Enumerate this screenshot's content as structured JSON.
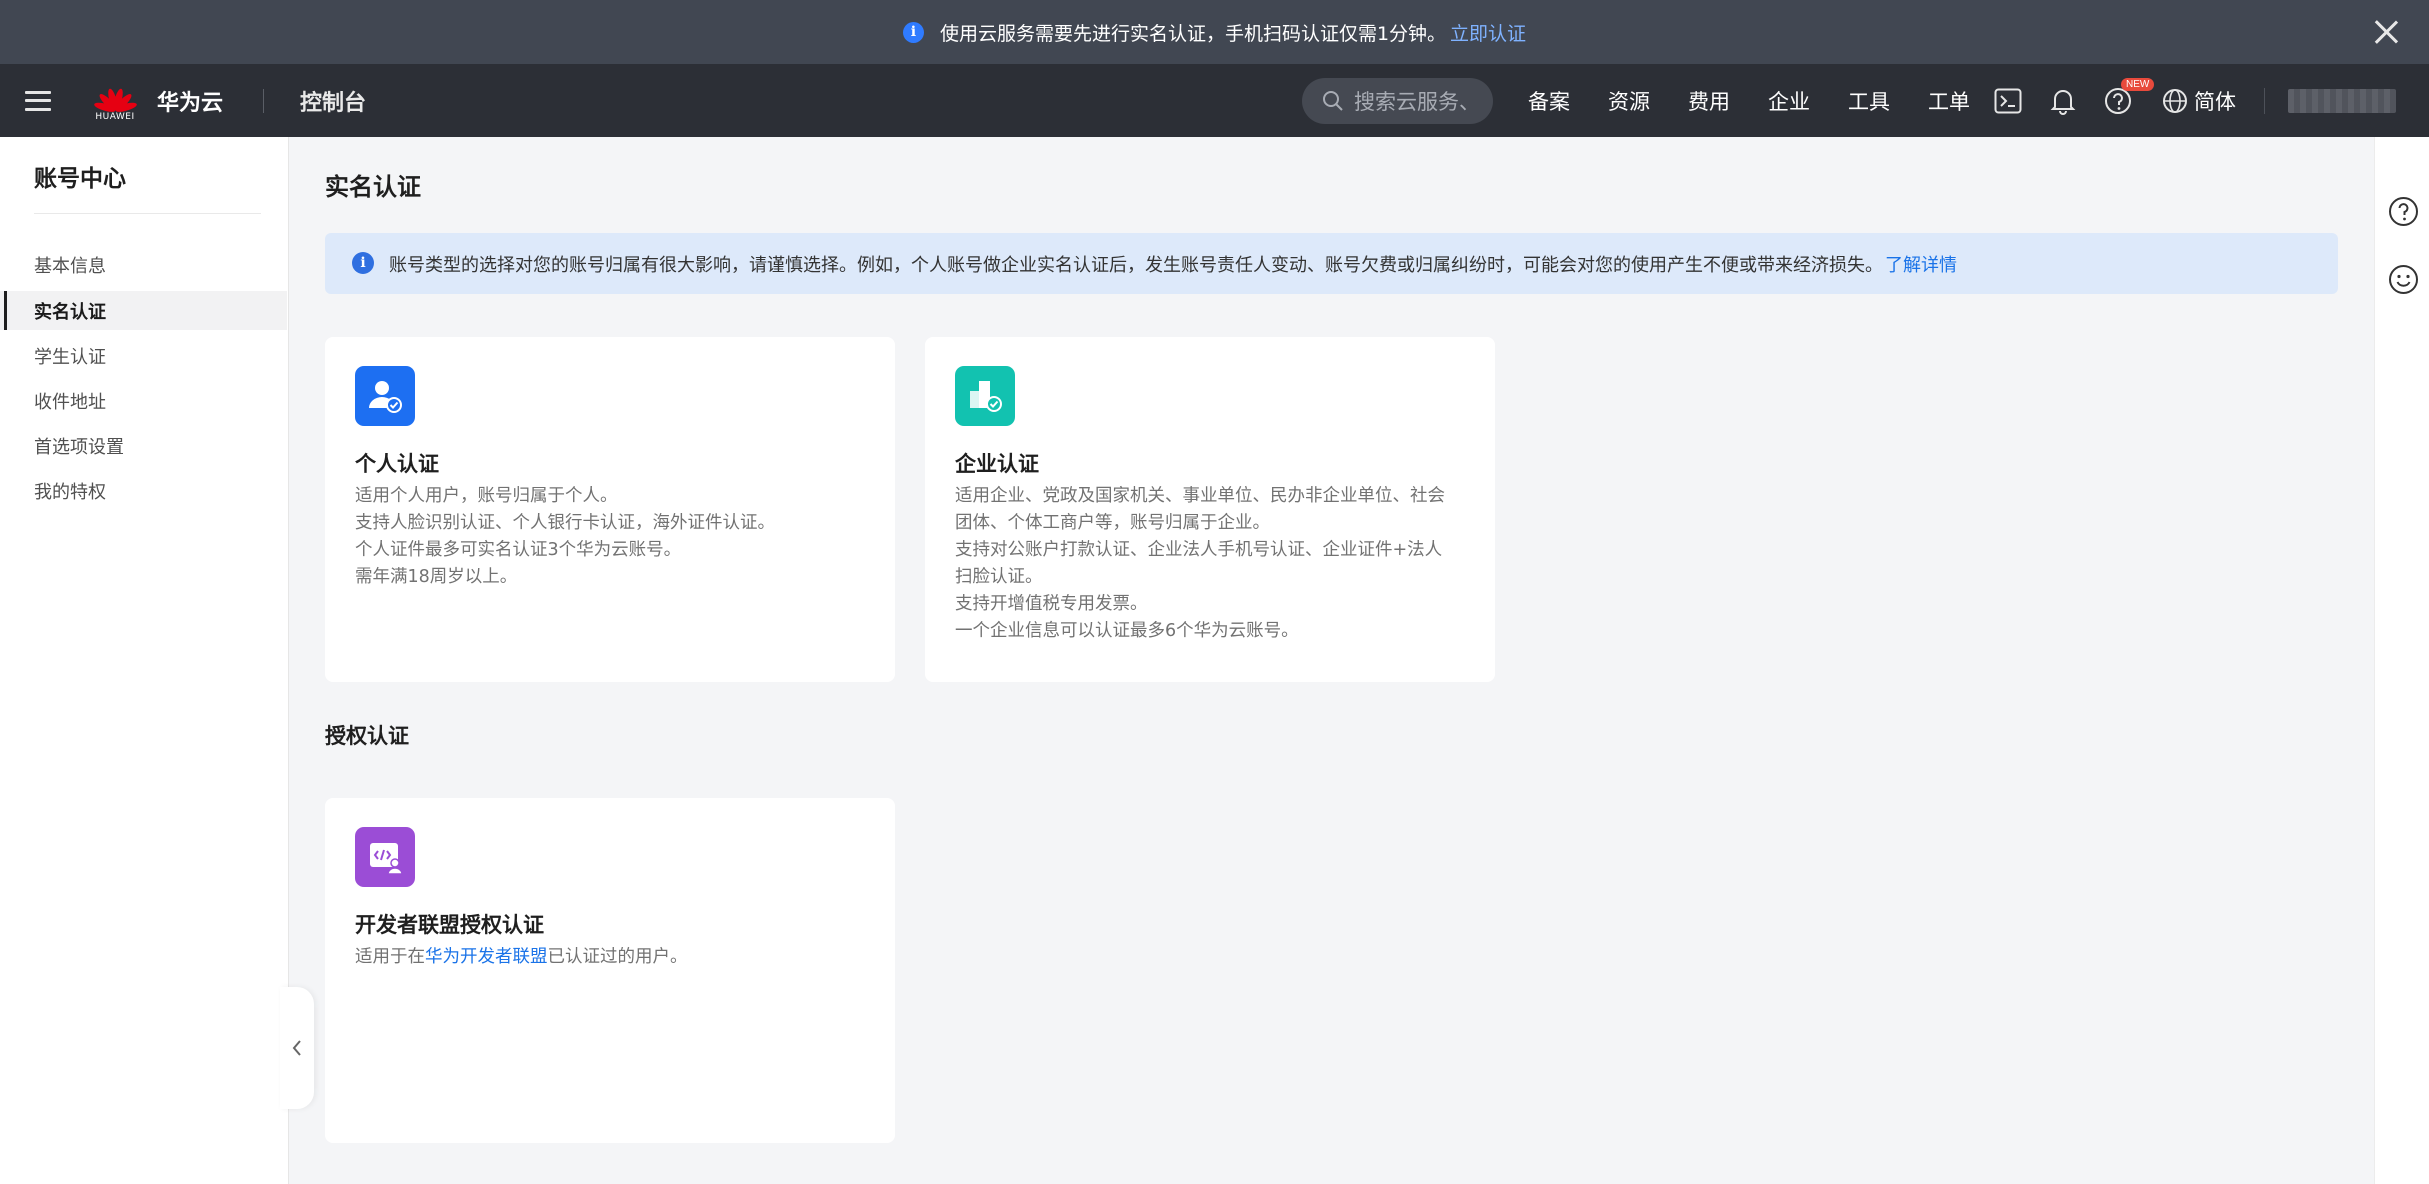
{
  "notice": {
    "text": "使用云服务需要先进行实名认证，手机扫码认证仅需1分钟。",
    "link": "立即认证",
    "info_icon": "info-icon",
    "close_icon": "close-icon"
  },
  "topbar": {
    "brand": "华为云",
    "logo_text": "HUAWEI",
    "console": "控制台",
    "search_placeholder": "搜索云服务、",
    "nav": [
      "备案",
      "资源",
      "费用",
      "企业",
      "工具",
      "工单"
    ],
    "icons": [
      "terminal-icon",
      "bell-icon",
      "help-icon"
    ],
    "new_badge": "NEW",
    "language": "简体"
  },
  "sidebar": {
    "title": "账号中心",
    "items": [
      {
        "label": "基本信息",
        "active": false
      },
      {
        "label": "实名认证",
        "active": true
      },
      {
        "label": "学生认证",
        "active": false
      },
      {
        "label": "收件地址",
        "active": false
      },
      {
        "label": "首选项设置",
        "active": false
      },
      {
        "label": "我的特权",
        "active": false
      }
    ]
  },
  "main": {
    "page_title": "实名认证",
    "banner": {
      "text": "账号类型的选择对您的账号归属有很大影响，请谨慎选择。例如，个人账号做企业实名认证后，发生账号责任人变动、账号欠费或归属纠纷时，可能会对您的使用产生不便或带来经济损失。",
      "link": "了解详情"
    },
    "cards": [
      {
        "title": "个人认证",
        "icon": "personal-verify-icon",
        "icon_color": "#1d6ff2",
        "desc": "适用个人用户，账号归属于个人。\n支持人脸识别认证、个人银行卡认证，海外证件认证。\n个人证件最多可实名认证3个华为云账号。\n需年满18周岁以上。"
      },
      {
        "title": "企业认证",
        "icon": "enterprise-verify-icon",
        "icon_color": "#12c2b0",
        "desc": "适用企业、党政及国家机关、事业单位、民办非企业单位、社会\n团体、个体工商户等，账号归属于企业。\n支持对公账户打款认证、企业法人手机号认证、企业证件+法人\n扫脸认证。\n支持开增值税专用发票。\n一个企业信息可以认证最多6个华为云账号。"
      }
    ],
    "auth_section_title": "授权认证",
    "dev_card": {
      "title": "开发者联盟授权认证",
      "icon": "developer-verify-icon",
      "icon_color": "#9b4dd6",
      "desc_prefix": "适用于在",
      "desc_link": "华为开发者联盟",
      "desc_suffix": "已认证过的用户。"
    }
  },
  "right_rail": {
    "icons": [
      "question-icon",
      "feedback-smile-icon"
    ]
  },
  "colors": {
    "accent": "#1a73e8",
    "topbar_bg": "#2c2f36",
    "notice_bg": "#414752",
    "banner_bg": "#dde9fa"
  }
}
